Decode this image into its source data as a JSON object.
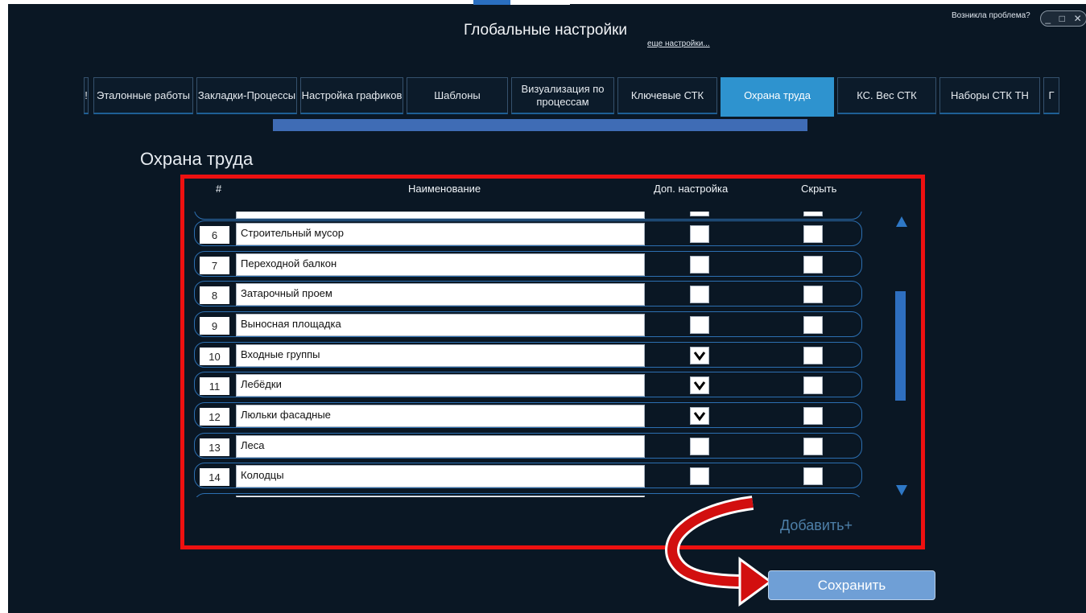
{
  "window": {
    "title": "Глобальные настройки",
    "more_link": "еще настройки...",
    "problem_link": "Возникла проблема?",
    "controls": {
      "minimize": "_",
      "maximize": "□",
      "close": "✕"
    }
  },
  "tabs": [
    {
      "label": "!"
    },
    {
      "label": "Эталонные работы"
    },
    {
      "label": "Закладки-Процессы"
    },
    {
      "label": "Настройка графиков"
    },
    {
      "label": "Шаблоны"
    },
    {
      "label": "Визуализация по процессам"
    },
    {
      "label": "Ключевые СТК"
    },
    {
      "label": "Охрана труда",
      "active": true
    },
    {
      "label": "КС. Вес СТК"
    },
    {
      "label": "Наборы СТК ТН"
    },
    {
      "label": "Г"
    }
  ],
  "section": {
    "title": "Охрана труда",
    "columns": {
      "num": "#",
      "name": "Наименование",
      "extra": "Доп. настройка",
      "hide": "Скрыть"
    },
    "rows": [
      {
        "num": "6",
        "name": "Строительный мусор",
        "extra": false,
        "hide": false
      },
      {
        "num": "7",
        "name": "Переходной балкон",
        "extra": false,
        "hide": false
      },
      {
        "num": "8",
        "name": "Затарочный проем",
        "extra": false,
        "hide": false
      },
      {
        "num": "9",
        "name": "Выносная площадка",
        "extra": false,
        "hide": false
      },
      {
        "num": "10",
        "name": "Входные группы",
        "extra": true,
        "hide": false
      },
      {
        "num": "11",
        "name": "Лебёдки",
        "extra": true,
        "hide": false
      },
      {
        "num": "12",
        "name": "Люльки фасадные",
        "extra": true,
        "hide": false
      },
      {
        "num": "13",
        "name": "Леса",
        "extra": false,
        "hide": false
      },
      {
        "num": "14",
        "name": "Колодцы",
        "extra": false,
        "hide": false
      }
    ],
    "add_label": "Добавить+",
    "save_label": "Сохранить"
  },
  "colors": {
    "accent": "#2e93cf",
    "highlight": "#ee1010",
    "background": "#0a1724"
  }
}
